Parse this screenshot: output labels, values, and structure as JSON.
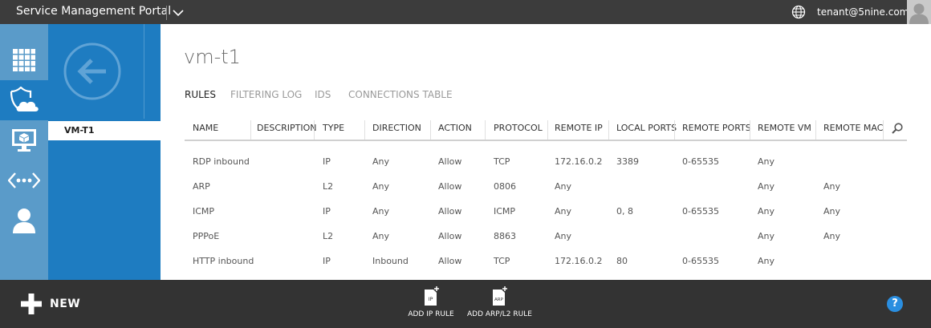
{
  "header": {
    "portal_title": "Service Management Portal",
    "user": "tenant@5nine.com",
    "icons": [
      "chevron-down-icon",
      "globe-icon",
      "user-avatar-icon"
    ]
  },
  "nav": {
    "icons": [
      "all-items-grid-icon",
      "shield-cloud-icon",
      "virtual-machine-icon",
      "networking-icon",
      "my-account-icon"
    ],
    "active_index": 1
  },
  "subnav": {
    "back_icon": "back-arrow-icon",
    "items": [
      "VM-T1"
    ]
  },
  "page": {
    "title": "vm-t1",
    "tabs": [
      "RULES",
      "FILTERING LOG",
      "IDS",
      "CONNECTIONS TABLE"
    ],
    "active_tab": "RULES"
  },
  "table": {
    "columns": [
      "NAME",
      "DESCRIPTION",
      "TYPE",
      "DIRECTION",
      "ACTION",
      "PROTOCOL",
      "REMOTE IP",
      "LOCAL PORTS",
      "REMOTE PORTS",
      "REMOTE VM",
      "REMOTE MAC"
    ],
    "rows": [
      [
        "RDP inbound",
        "",
        "IP",
        "Any",
        "Allow",
        "TCP",
        "172.16.0.2",
        "3389",
        "0-65535",
        "Any",
        ""
      ],
      [
        "ARP",
        "",
        "L2",
        "Any",
        "Allow",
        "0806",
        "Any",
        "",
        "",
        "Any",
        "Any"
      ],
      [
        "ICMP",
        "",
        "IP",
        "Any",
        "Allow",
        "ICMP",
        "Any",
        "0, 8",
        "0-65535",
        "Any",
        "Any"
      ],
      [
        "PPPoE",
        "",
        "L2",
        "Any",
        "Allow",
        "8863",
        "Any",
        "",
        "",
        "Any",
        "Any"
      ],
      [
        "HTTP inbound",
        "",
        "IP",
        "Inbound",
        "Allow",
        "TCP",
        "172.16.0.2",
        "80",
        "0-65535",
        "Any",
        ""
      ]
    ]
  },
  "commandbar": {
    "new_label": "NEW",
    "add_ip_rule": "ADD IP RULE",
    "add_arp_rule": "ADD ARP/L2 RULE",
    "ip_icon_text": "IP",
    "arp_icon_text": "ARP",
    "help_label": "?"
  },
  "colors": {
    "topbar": "#3c3c3c",
    "nav": "#5a9bc9",
    "accent": "#1e7cc1",
    "commandbar": "#333333",
    "help": "#2a8ee0"
  }
}
